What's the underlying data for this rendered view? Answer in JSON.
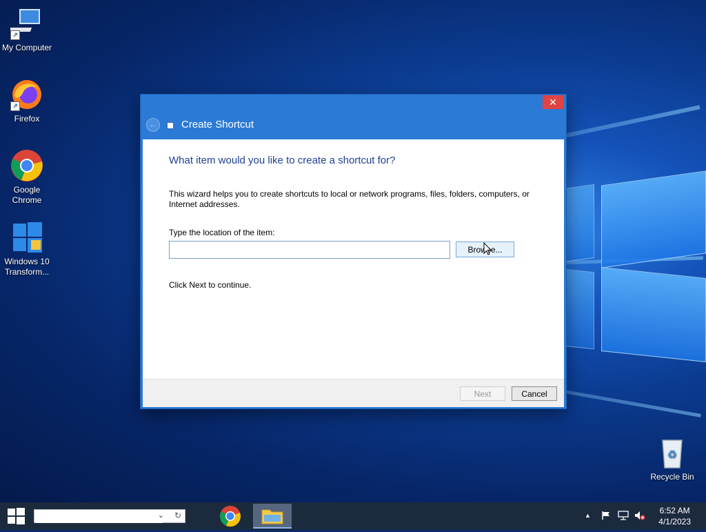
{
  "desktop": {
    "icons": [
      {
        "label": "My Computer"
      },
      {
        "label": "Firefox"
      },
      {
        "label": "Google Chrome"
      },
      {
        "label": "Windows 10 Transform..."
      },
      {
        "label": "Recycle Bin"
      }
    ]
  },
  "dialog": {
    "title": "Create Shortcut",
    "close_glyph": "✕",
    "back_glyph": "←",
    "heading": "What item would you like to create a shortcut for?",
    "description": "This wizard helps you to create shortcuts to local or network programs, files, folders, computers, or Internet addresses.",
    "location_label": "Type the location of the item:",
    "location_value": "",
    "browse_label": "Browse...",
    "continue_text": "Click Next to continue.",
    "next_label": "Next",
    "cancel_label": "Cancel"
  },
  "taskbar": {
    "search_value": "",
    "search_dropdown_glyph": "⌄",
    "search_refresh_glyph": "↻",
    "apps": [
      {
        "name": "Google Chrome",
        "active": false
      },
      {
        "name": "File Explorer",
        "active": true
      }
    ],
    "tray_arrow": "▲",
    "clock_time": "6:52 AM",
    "clock_date": "4/1/2023"
  },
  "colors": {
    "dialog_frame": "#2b7ad6",
    "heading": "#1c3f94",
    "close_button": "#e04343",
    "taskbar": "#1c2a3e"
  }
}
